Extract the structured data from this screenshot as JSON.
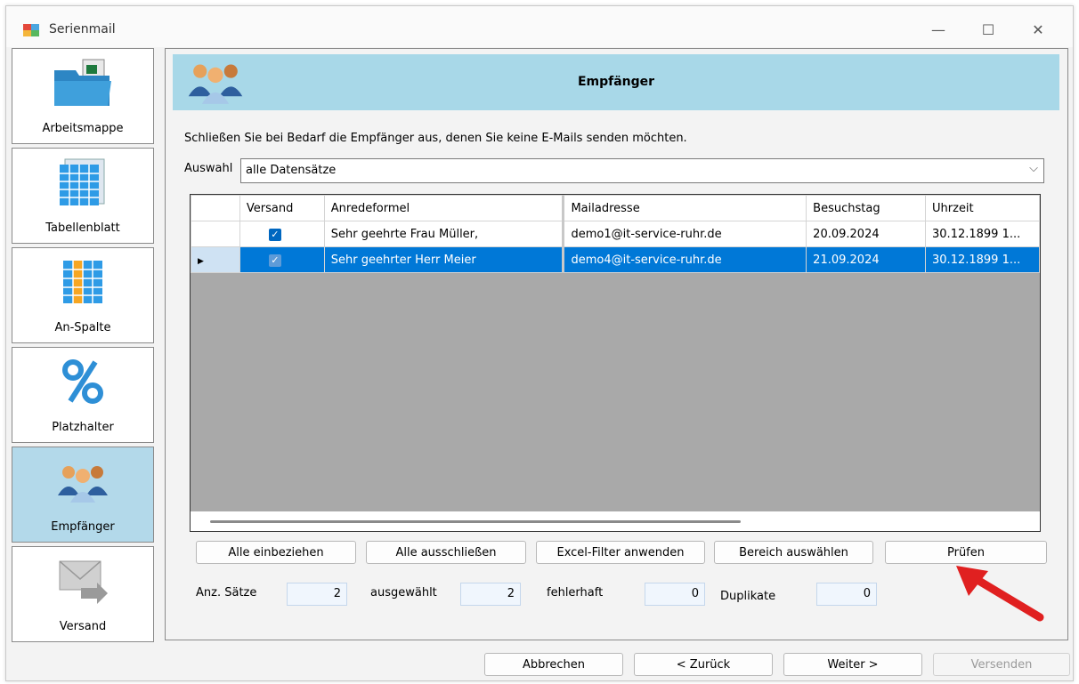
{
  "window": {
    "title": "Serienmail",
    "minimize": "—",
    "maximize": "☐",
    "close": "✕"
  },
  "nav": [
    {
      "label": "Arbeitsmappe",
      "icon": "workbook-folder-icon"
    },
    {
      "label": "Tabellenblatt",
      "icon": "spreadsheet-icon"
    },
    {
      "label": "An-Spalte",
      "icon": "column-icon"
    },
    {
      "label": "Platzhalter",
      "icon": "percent-icon"
    },
    {
      "label": "Empfänger",
      "icon": "people-icon",
      "active": true
    },
    {
      "label": "Versand",
      "icon": "envelope-icon"
    }
  ],
  "header": {
    "title": "Empfänger"
  },
  "instruction": "Schließen Sie bei Bedarf die Empfänger aus, denen Sie keine E-Mails senden möchten.",
  "auswahl": {
    "label": "Auswahl",
    "value": "alle Datensätze"
  },
  "grid": {
    "columns": [
      "Versand",
      "Anredeformel",
      "Mailadresse",
      "Besuchstag",
      "Uhrzeit"
    ],
    "rows": [
      {
        "versand": "✓",
        "anrede": "Sehr geehrte Frau  Müller,",
        "mail": "demo1@it-service-ruhr.de",
        "tag": "20.09.2024",
        "zeit": "30.12.1899 1..."
      },
      {
        "versand": "✓",
        "anrede": "Sehr geehrter Herr Meier",
        "mail": "demo4@it-service-ruhr.de",
        "tag": "21.09.2024",
        "zeit": "30.12.1899 1...",
        "selected": true,
        "marker": "▶"
      }
    ]
  },
  "actions": {
    "include_all": "Alle einbeziehen",
    "exclude_all": "Alle ausschließen",
    "excel_filter": "Excel-Filter anwenden",
    "select_range": "Bereich auswählen",
    "check": "Prüfen"
  },
  "stats": {
    "count_label": "Anz. Sätze",
    "count": "2",
    "selected_label": "ausgewählt",
    "selected": "2",
    "errors_label": "fehlerhaft",
    "errors": "0",
    "dupes_label": "Duplikate",
    "dupes": "0"
  },
  "footer": {
    "cancel": "Abbrechen",
    "back": "< Zurück",
    "next": "Weiter >",
    "send": "Versenden"
  },
  "colors": {
    "accent": "#0078d7",
    "header": "#a8d8e8",
    "arrow": "#e02020"
  }
}
